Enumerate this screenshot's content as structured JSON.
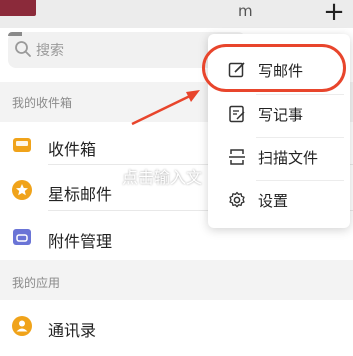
{
  "header": {
    "partial_text": "m",
    "add_symbol": "+"
  },
  "search": {
    "placeholder": "搜索"
  },
  "sections": {
    "inbox_section": "我的收件箱",
    "apps_section": "我的应用"
  },
  "mailbox": [
    {
      "label": "收件箱",
      "icon": "inbox-icon",
      "color": "#f0a31a"
    },
    {
      "label": "星标邮件",
      "icon": "star-icon",
      "color": "#f0a31a"
    },
    {
      "label": "附件管理",
      "icon": "attachment-icon",
      "color": "#6a74d6"
    }
  ],
  "apps": [
    {
      "label": "通讯录",
      "icon": "contacts-icon",
      "color": "#f0a31a"
    }
  ],
  "overlay": {
    "text": "点击输入文"
  },
  "menu": [
    {
      "label": "写邮件",
      "icon": "compose-icon"
    },
    {
      "label": "写记事",
      "icon": "note-icon"
    },
    {
      "label": "扫描文件",
      "icon": "scan-icon"
    },
    {
      "label": "设置",
      "icon": "gear-icon"
    }
  ],
  "colors": {
    "highlight": "#e8452c",
    "accent_orange": "#f0a31a",
    "attachment_purple": "#6a74d6"
  }
}
